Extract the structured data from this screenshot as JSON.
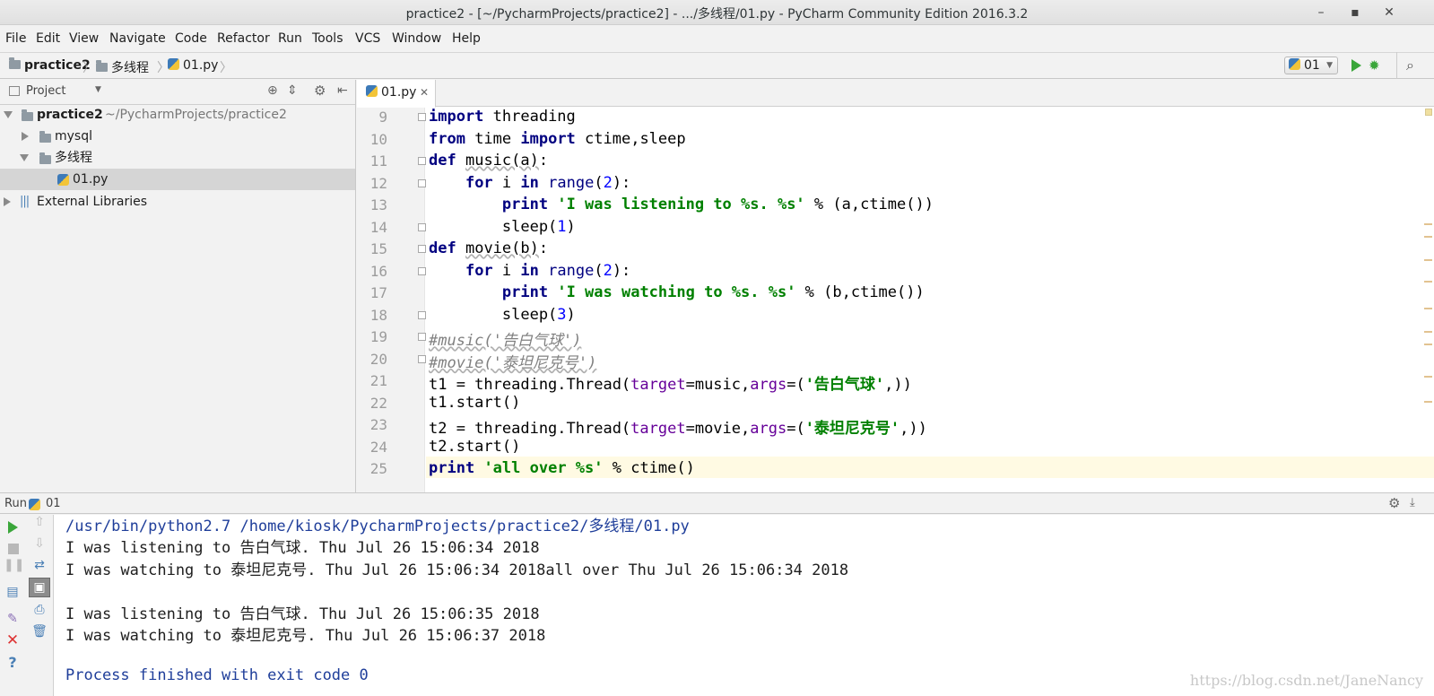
{
  "window": {
    "title": "practice2 - [~/PycharmProjects/practice2] - .../多线程/01.py - PyCharm Community Edition 2016.3.2"
  },
  "menu": [
    "File",
    "Edit",
    "View",
    "Navigate",
    "Code",
    "Refactor",
    "Run",
    "Tools",
    "VCS",
    "Window",
    "Help"
  ],
  "breadcrumb": [
    "practice2",
    "多线程",
    "01.py"
  ],
  "run_config": "01",
  "project_panel": {
    "title": "Project",
    "tree": [
      {
        "label": "practice2",
        "path": "~/PycharmProjects/practice2"
      },
      {
        "label": "mysql"
      },
      {
        "label": "多线程"
      },
      {
        "label": "01.py"
      },
      {
        "label": "External Libraries"
      }
    ]
  },
  "editor": {
    "tab": "01.py",
    "line_numbers": [
      "9",
      "10",
      "11",
      "12",
      "13",
      "14",
      "15",
      "16",
      "17",
      "18",
      "19",
      "20",
      "21",
      "22",
      "23",
      "24",
      "25"
    ]
  },
  "run_panel": {
    "title": "Run",
    "config": "01",
    "output": [
      "/usr/bin/python2.7 /home/kiosk/PycharmProjects/practice2/多线程/01.py",
      "I was listening to 告白气球. Thu Jul 26 15:06:34 2018",
      "I was watching to 泰坦尼克号. Thu Jul 26 15:06:34 2018all over Thu Jul 26 15:06:34 2018",
      "",
      "I was listening to 告白气球. Thu Jul 26 15:06:35 2018",
      "I was watching to 泰坦尼克号. Thu Jul 26 15:06:37 2018",
      "",
      "Process finished with exit code 0"
    ]
  },
  "watermark": "https://blog.csdn.net/JaneNancy",
  "colors": {
    "keyword": "#000080",
    "string": "#008000",
    "number": "#0000ff",
    "comment": "#808080",
    "kwarg": "#660099",
    "console_path": "#1f3e9a"
  },
  "icons": [
    "minimize-icon",
    "maximize-icon",
    "close-icon",
    "folder-icon",
    "python-file-icon",
    "run-icon",
    "debug-icon",
    "search-icon",
    "gear-icon",
    "target-icon",
    "collapse-icon",
    "stop-icon",
    "pause-icon",
    "rerun-icon",
    "up-icon",
    "down-icon",
    "wrap-icon",
    "print-icon",
    "trash-icon",
    "pin-icon",
    "help-icon"
  ]
}
